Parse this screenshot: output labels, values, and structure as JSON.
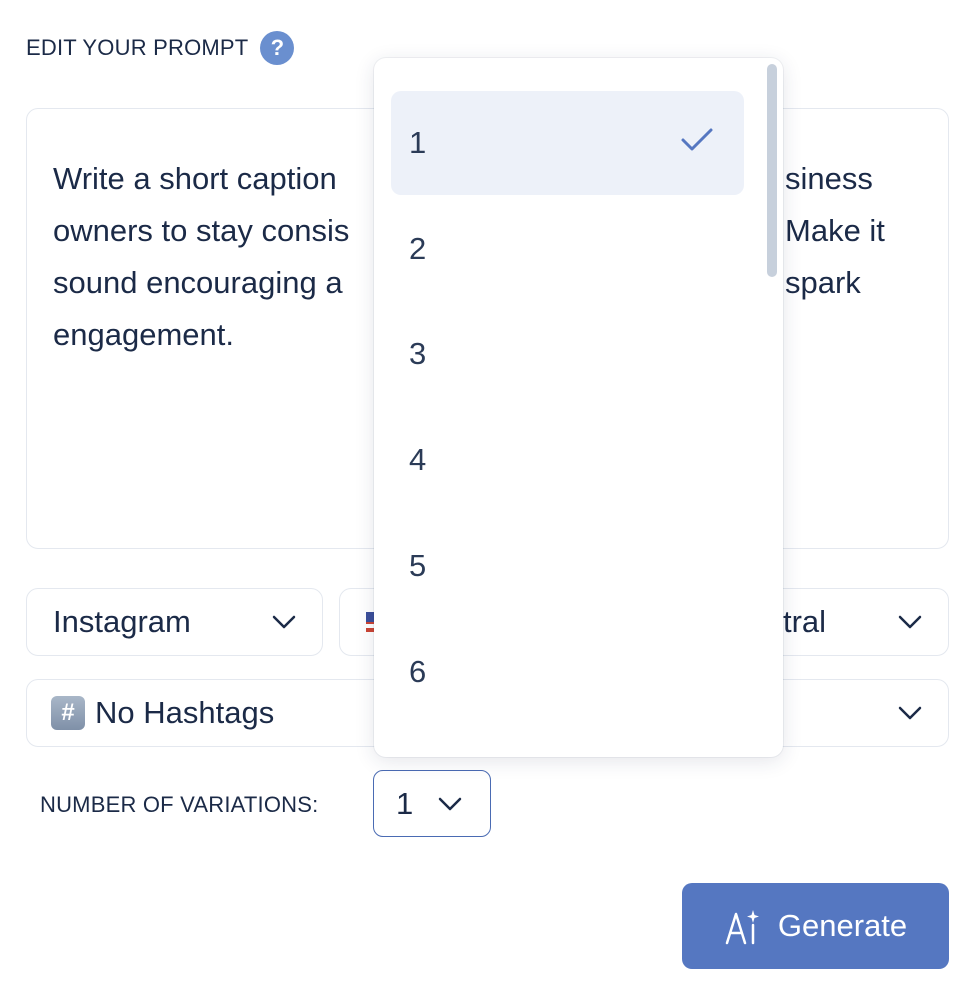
{
  "prompt_section": {
    "label": "EDIT YOUR PROMPT",
    "help_icon": "?",
    "text_visible": "Write a short caption\nowners to stay consis\nsound encouraging a\nengagement.",
    "line_right_1": "siness",
    "line_right_2": "Make it",
    "line_right_3": "spark"
  },
  "platform_select": {
    "value": "Instagram",
    "icon": "chevron-down-icon"
  },
  "language_select": {
    "icon": "us-flag-icon"
  },
  "tone_select": {
    "value_partial": "tral",
    "icon": "chevron-down-icon"
  },
  "hashtags_select": {
    "icon_glyph": "#",
    "value": "No Hashtags"
  },
  "variations": {
    "label": "NUMBER OF VARIATIONS:",
    "value": "1",
    "options": [
      "1",
      "2",
      "3",
      "4",
      "5",
      "6"
    ],
    "selected": "1"
  },
  "generate_button": {
    "label": "Generate",
    "icon": "ai-sparkle-icon"
  },
  "colors": {
    "accent": "#5577c1",
    "text": "#1b2a47",
    "selected_bg": "#edf1f9",
    "check": "#5577c1"
  }
}
